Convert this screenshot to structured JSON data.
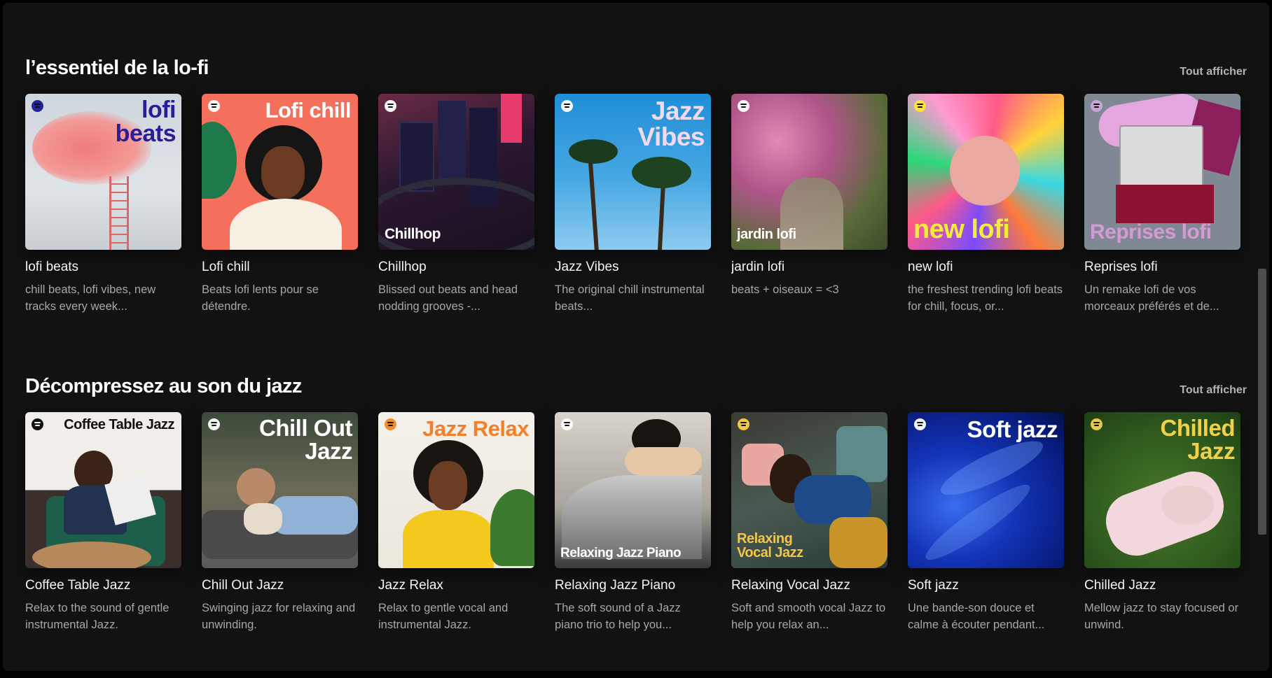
{
  "sections": [
    {
      "title": "l’essentiel de la lo-fi",
      "show_all": "Tout afficher",
      "cards": [
        {
          "name": "lofi beats",
          "cover_text": "lofi beats",
          "desc": "chill beats, lofi vibes, new tracks every week..."
        },
        {
          "name": "Lofi chill",
          "cover_text": "Lofi chill",
          "desc": "Beats lofi lents pour se détendre."
        },
        {
          "name": "Chillhop",
          "cover_text": "Chillhop",
          "desc": "Blissed out beats and head nodding grooves -..."
        },
        {
          "name": "Jazz Vibes",
          "cover_text": "Jazz Vibes",
          "desc": "The original chill instrumental beats..."
        },
        {
          "name": "jardin lofi",
          "cover_text": "jardin lofi",
          "desc": "beats + oiseaux = <3"
        },
        {
          "name": "new lofi",
          "cover_text": "new lofi",
          "desc": "the freshest trending lofi beats for chill, focus, or..."
        },
        {
          "name": "Reprises lofi",
          "cover_text": "Reprises lofi",
          "desc": "Un remake lofi de vos morceaux préférés et de..."
        }
      ]
    },
    {
      "title": "Décompressez au son du jazz",
      "show_all": "Tout afficher",
      "cards": [
        {
          "name": "Coffee Table Jazz",
          "cover_text": "Coffee Table Jazz",
          "desc": "Relax to the sound of gentle instrumental Jazz."
        },
        {
          "name": "Chill Out Jazz",
          "cover_text": "Chill Out Jazz",
          "desc": "Swinging jazz for relaxing and unwinding."
        },
        {
          "name": "Jazz Relax",
          "cover_text": "Jazz Relax",
          "desc": "Relax to gentle vocal and instrumental Jazz."
        },
        {
          "name": "Relaxing Jazz Piano",
          "cover_text": "Relaxing Jazz Piano",
          "desc": "The soft sound of a Jazz piano trio to help you..."
        },
        {
          "name": "Relaxing Vocal Jazz",
          "cover_text": "Relaxing Vocal Jazz",
          "desc": "Soft and smooth vocal Jazz to help you relax an..."
        },
        {
          "name": "Soft jazz",
          "cover_text": "Soft jazz",
          "desc": "Une bande-son douce et calme à écouter pendant..."
        },
        {
          "name": "Chilled Jazz",
          "cover_text": "Chilled Jazz",
          "desc": "Mellow jazz to stay focused or unwind."
        }
      ]
    }
  ],
  "colors": {
    "background": "#121212",
    "text_primary": "#ffffff",
    "text_secondary": "#a7a7a7",
    "show_all": "#b3b3b3"
  },
  "icons": [
    "spotify-logo-icon"
  ]
}
